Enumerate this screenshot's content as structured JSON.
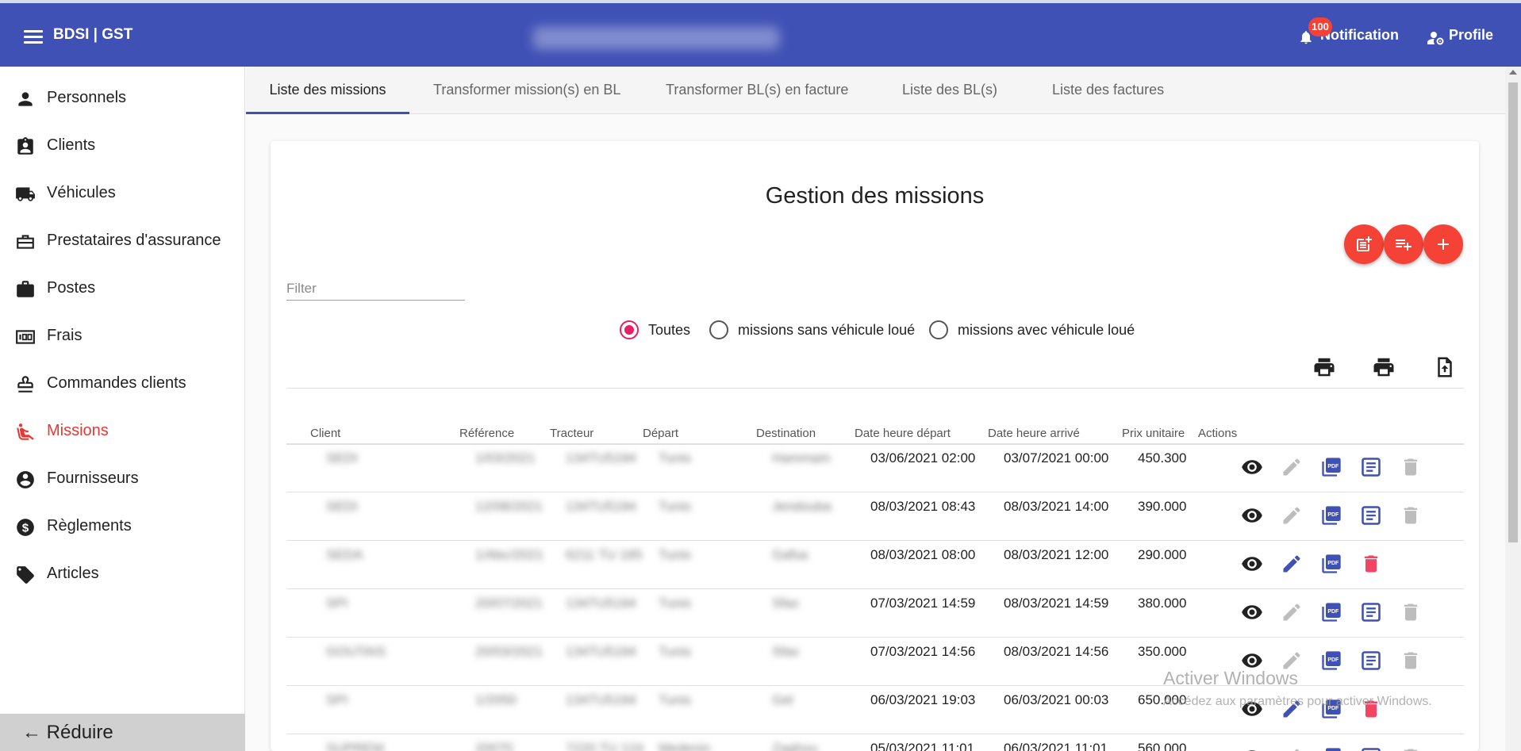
{
  "header": {
    "brand": "BDSI | GST",
    "notification_label": "Notification",
    "notification_count": "100",
    "profile_label": "Profile"
  },
  "sidebar": {
    "items": [
      {
        "label": "Personnels",
        "icon": "person-icon"
      },
      {
        "label": "Clients",
        "icon": "contact-badge-icon"
      },
      {
        "label": "Véhicules",
        "icon": "truck-icon"
      },
      {
        "label": "Prestataires d'assurance",
        "icon": "briefcase-outline-icon"
      },
      {
        "label": "Postes",
        "icon": "briefcase-icon"
      },
      {
        "label": "Frais",
        "icon": "counter-icon"
      },
      {
        "label": "Commandes clients",
        "icon": "stamp-icon"
      },
      {
        "label": "Missions",
        "icon": "seat-icon",
        "active": true
      },
      {
        "label": "Fournisseurs",
        "icon": "account-circle-icon"
      },
      {
        "label": "Règlements",
        "icon": "dollar-icon"
      },
      {
        "label": "Articles",
        "icon": "tag-icon"
      }
    ],
    "reduce_label": "Réduire"
  },
  "tabs": [
    {
      "label": "Liste des missions",
      "active": true
    },
    {
      "label": "Transformer mission(s) en BL"
    },
    {
      "label": "Transformer BL(s) en facture"
    },
    {
      "label": "Liste des BL(s)"
    },
    {
      "label": "Liste des factures"
    }
  ],
  "main": {
    "title": "Gestion des missions",
    "filter_placeholder": "Filter",
    "radios": [
      {
        "label": "Toutes",
        "checked": true
      },
      {
        "label": "missions sans véhicule loué"
      },
      {
        "label": "missions avec véhicule loué"
      }
    ]
  },
  "table": {
    "columns": [
      "Client",
      "Référence",
      "Tracteur",
      "Départ",
      "Destination",
      "Date heure départ",
      "Date heure arrivé",
      "Prix unitaire",
      "Actions"
    ],
    "rows": [
      {
        "client": "SEDI",
        "reference": "1/03/2021",
        "tracteur": "134TU5194",
        "depart": "Tunis",
        "destination": "Hammam",
        "date_depart": "03/06/2021 02:00",
        "date_arrivee": "03/07/2021 00:00",
        "prix": "450.300",
        "editable": false
      },
      {
        "client": "SEDI",
        "reference": "12/08/2021",
        "tracteur": "134TU5194",
        "depart": "Tunis",
        "destination": "Jendouba",
        "date_depart": "08/03/2021 08:43",
        "date_arrivee": "08/03/2021 14:00",
        "prix": "390.000",
        "editable": false
      },
      {
        "client": "SEDA",
        "reference": "1/Abc/2021",
        "tracteur": "6211 TU 185",
        "depart": "Tunis",
        "destination": "Gafsa",
        "date_depart": "08/03/2021 08:00",
        "date_arrivee": "08/03/2021 12:00",
        "prix": "290.000",
        "editable": true
      },
      {
        "client": "SPI",
        "reference": "20/07/2021",
        "tracteur": "134TU5194",
        "depart": "Tunis",
        "destination": "Sfax",
        "date_depart": "07/03/2021 14:59",
        "date_arrivee": "08/03/2021 14:59",
        "prix": "380.000",
        "editable": false
      },
      {
        "client": "GOUTAIS",
        "reference": "20/03/2021",
        "tracteur": "134TU5194",
        "depart": "Tunis",
        "destination": "Sfax",
        "date_depart": "07/03/2021 14:56",
        "date_arrivee": "08/03/2021 14:56",
        "prix": "350.000",
        "editable": false
      },
      {
        "client": "SPI",
        "reference": "1/2050",
        "tracteur": "134TU5194",
        "depart": "Tunis",
        "destination": "Gel",
        "date_depart": "06/03/2021 19:03",
        "date_arrivee": "06/03/2021 00:03",
        "prix": "650.000",
        "editable": true
      },
      {
        "client": "SUPREM",
        "reference": "20070",
        "tracteur": "7220 TU 124",
        "depart": "Medenin",
        "destination": "Zaghou",
        "date_depart": "05/03/2021 11:01",
        "date_arrivee": "06/03/2021 11:01",
        "prix": "560.000",
        "editable": false
      }
    ]
  },
  "watermark": {
    "line1": "Activer Windows",
    "line2": "Accédez aux paramètres pour activer Windows."
  },
  "colors": {
    "primary": "#3f51b5",
    "accent": "#f44336",
    "radio": "#e91e63",
    "active_nav": "#e53935"
  }
}
